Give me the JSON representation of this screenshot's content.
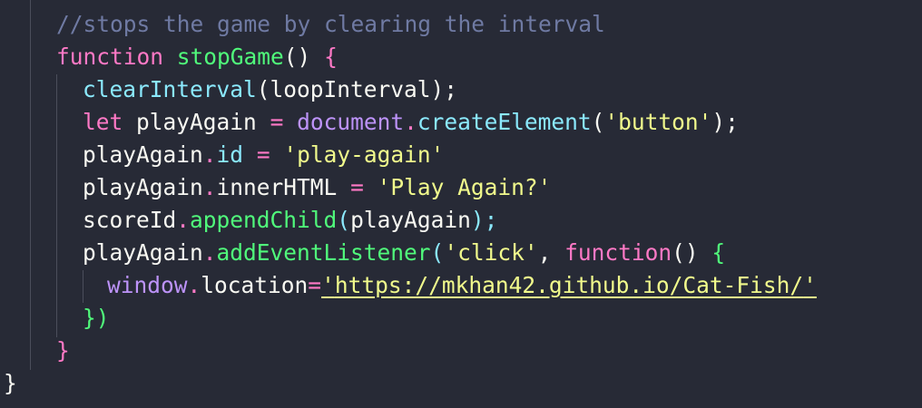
{
  "code": {
    "l1": {
      "comment": "//stops the game by clearing the interval"
    },
    "l2": {
      "kw": "function",
      "name": "stopGame",
      "parens": "()",
      "brace": "{"
    },
    "l3": {
      "fn": "clearInterval",
      "open": "(",
      "arg": "loopInterval",
      "close": ");"
    },
    "l4": {
      "kw": "let",
      "var": "playAgain",
      "eq": "=",
      "obj": "document",
      "dot": ".",
      "fn": "createElement",
      "open": "(",
      "str": "'button'",
      "close": ");"
    },
    "l5": {
      "var": "playAgain",
      "dot": ".",
      "prop": "id",
      "eq": "=",
      "str": "'play-again'"
    },
    "l6": {
      "var": "playAgain",
      "dot": ".",
      "prop": "innerHTML",
      "eq": "=",
      "str": "'Play Again?'"
    },
    "l7": {
      "var": "scoreId",
      "dot": ".",
      "fn": "appendChild",
      "open": "(",
      "arg": "playAgain",
      "close": ");"
    },
    "l8": {
      "var": "playAgain",
      "dot": ".",
      "fn": "addEventListener",
      "open": "(",
      "str": "'click'",
      "comma": ",",
      "kw": "function",
      "parens": "()",
      "brace": "{"
    },
    "l9": {
      "obj": "window",
      "dot": ".",
      "prop": "location",
      "eq": "=",
      "quote1": "'",
      "url": "https://mkhan42.github.io/Cat-Fish/",
      "quote2": "'"
    },
    "l10": {
      "brace": "})"
    },
    "l11": {
      "brace": "}"
    },
    "l12": {
      "brace": "}"
    }
  }
}
